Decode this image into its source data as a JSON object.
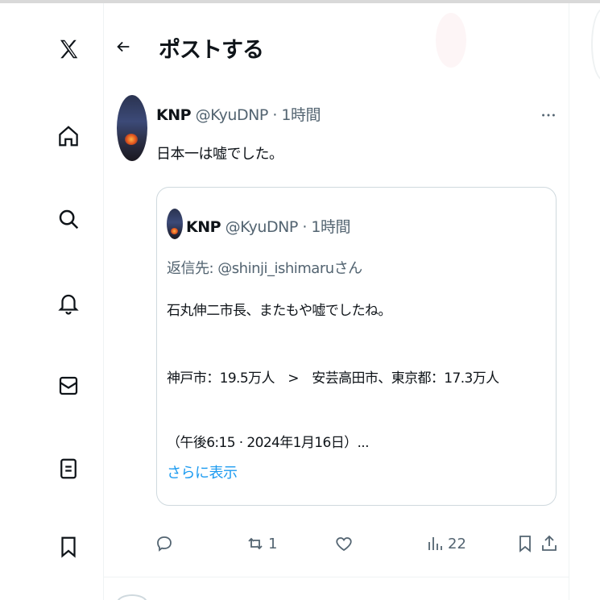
{
  "header": {
    "title": "ポストする"
  },
  "tweet": {
    "name": "KNP",
    "handle": "@KyuDNP",
    "separator": "·",
    "time": "1時間",
    "text": "日本一は嘘でした。"
  },
  "quote": {
    "name": "KNP",
    "handle": "@KyuDNP",
    "separator": "·",
    "time": "1時間",
    "reply_to": "返信先: @shinji_ishimaruさん",
    "lines": [
      "石丸伸二市長、またもや嘘でしたね。",
      "神戸市：19.5万人　>　安芸高田市、東京都：17.3万人",
      "（午後6:15 · 2024年1月16日）..."
    ],
    "show_more": "さらに表示"
  },
  "actions": {
    "reply_count": "",
    "repost_count": "1",
    "like_count": "",
    "views_count": "22"
  },
  "colors": {
    "accent": "#1d9bf0",
    "secondary_text": "#536471",
    "border": "#cfd9de"
  }
}
